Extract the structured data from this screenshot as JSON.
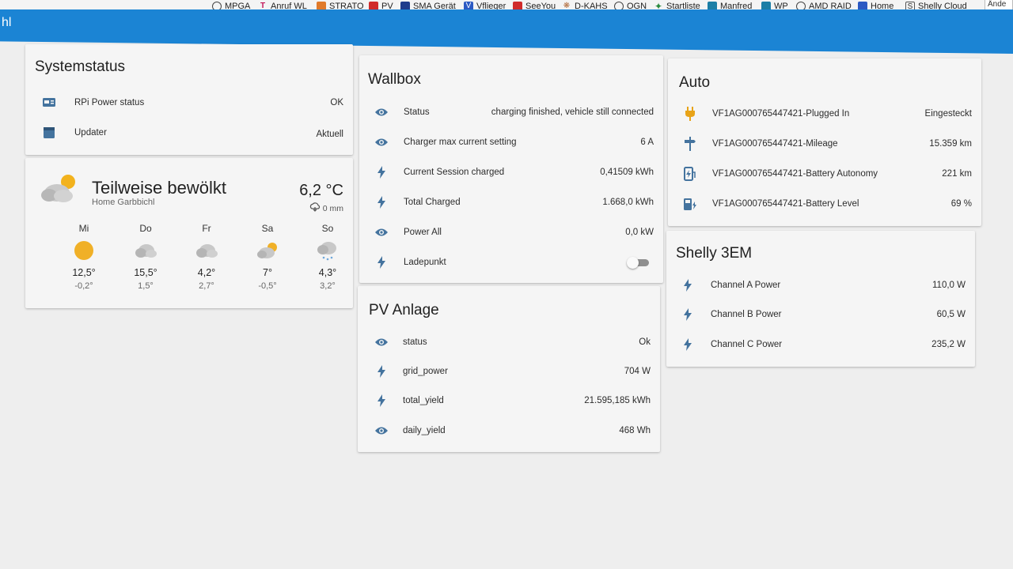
{
  "browser": {
    "bookmarks": [
      {
        "label": "MPGA",
        "icon": "globe-icon"
      },
      {
        "label": "Anruf WL",
        "icon": "telekom-icon"
      },
      {
        "label": "STRATO",
        "icon": "strato-icon"
      },
      {
        "label": "PV",
        "icon": "pv-icon"
      },
      {
        "label": "SMA Gerät",
        "icon": "sma-icon"
      },
      {
        "label": "Vflieger",
        "icon": "vflieger-icon"
      },
      {
        "label": "SeeYou",
        "icon": "seeyou-icon"
      },
      {
        "label": "D-KAHS",
        "icon": "paw-icon"
      },
      {
        "label": "OGN",
        "icon": "globe-icon"
      },
      {
        "label": "Startliste",
        "icon": "startliste-icon"
      },
      {
        "label": "Manfred",
        "icon": "manfred-icon"
      },
      {
        "label": "WP",
        "icon": "wp-icon"
      },
      {
        "label": "AMD RAID",
        "icon": "globe-icon"
      },
      {
        "label": "Home",
        "icon": "home-icon"
      },
      {
        "label": "Shelly Cloud",
        "icon": "shelly-icon"
      }
    ],
    "right_button": "Ände"
  },
  "header": {
    "title": "hl"
  },
  "systemstatus": {
    "title": "Systemstatus",
    "rows": [
      {
        "label": "RPi Power status",
        "value": "OK",
        "icon": "raspberry-status-icon"
      },
      {
        "label": "Updater",
        "value": "Aktuell",
        "icon": "package-icon"
      }
    ]
  },
  "weather": {
    "condition": "Teilweise bewölkt",
    "location": "Home Garbbichl",
    "temperature": "6,2 °C",
    "precipitation": "0 mm",
    "forecast": [
      {
        "day": "Mi",
        "high": "12,5°",
        "low": "-0,2°",
        "icon": "sunny-icon"
      },
      {
        "day": "Do",
        "high": "15,5°",
        "low": "1,5°",
        "icon": "cloudy-icon"
      },
      {
        "day": "Fr",
        "high": "4,2°",
        "low": "2,7°",
        "icon": "cloudy-icon"
      },
      {
        "day": "Sa",
        "high": "7°",
        "low": "-0,5°",
        "icon": "partly-cloudy-icon"
      },
      {
        "day": "So",
        "high": "4,3°",
        "low": "3,2°",
        "icon": "snowy-icon"
      }
    ]
  },
  "wallbox": {
    "title": "Wallbox",
    "rows": [
      {
        "label": "Status",
        "value": "charging finished, vehicle still connected",
        "icon": "eye-icon"
      },
      {
        "label": "Charger max current setting",
        "value": "6 A",
        "icon": "eye-icon"
      },
      {
        "label": "Current Session charged",
        "value": "0,41509 kWh",
        "icon": "flash-icon"
      },
      {
        "label": "Total Charged",
        "value": "1.668,0 kWh",
        "icon": "flash-icon"
      },
      {
        "label": "Power All",
        "value": "0,0 kW",
        "icon": "eye-icon"
      },
      {
        "label": "Ladepunkt",
        "value": "off",
        "icon": "flash-icon"
      }
    ]
  },
  "pv": {
    "title": "PV Anlage",
    "rows": [
      {
        "label": "status",
        "value": "Ok",
        "icon": "eye-icon"
      },
      {
        "label": "grid_power",
        "value": "704 W",
        "icon": "flash-icon"
      },
      {
        "label": "total_yield",
        "value": "21.595,185 kWh",
        "icon": "flash-icon"
      },
      {
        "label": "daily_yield",
        "value": "468 Wh",
        "icon": "eye-icon"
      }
    ]
  },
  "auto": {
    "title": "Auto",
    "rows": [
      {
        "label": "VF1AG000765447421-Plugged In",
        "value": "Eingesteckt",
        "icon": "power-plug-icon"
      },
      {
        "label": "VF1AG000765447421-Mileage",
        "value": "15.359 km",
        "icon": "sign-direction-icon"
      },
      {
        "label": "VF1AG000765447421-Battery Autonomy",
        "value": "221 km",
        "icon": "ev-station-icon"
      },
      {
        "label": "VF1AG000765447421-Battery Level",
        "value": "69 %",
        "icon": "gas-station-icon"
      }
    ]
  },
  "shelly": {
    "title": "Shelly 3EM",
    "rows": [
      {
        "label": "Channel A Power",
        "value": "110,0 W",
        "icon": "flash-icon"
      },
      {
        "label": "Channel B Power",
        "value": "60,5 W",
        "icon": "flash-icon"
      },
      {
        "label": "Channel C Power",
        "value": "235,2 W",
        "icon": "flash-icon"
      }
    ]
  },
  "colors": {
    "header": "#1b84d4",
    "icon": "#44739e",
    "card": "#f5f5f5",
    "background": "#eeeeee"
  }
}
